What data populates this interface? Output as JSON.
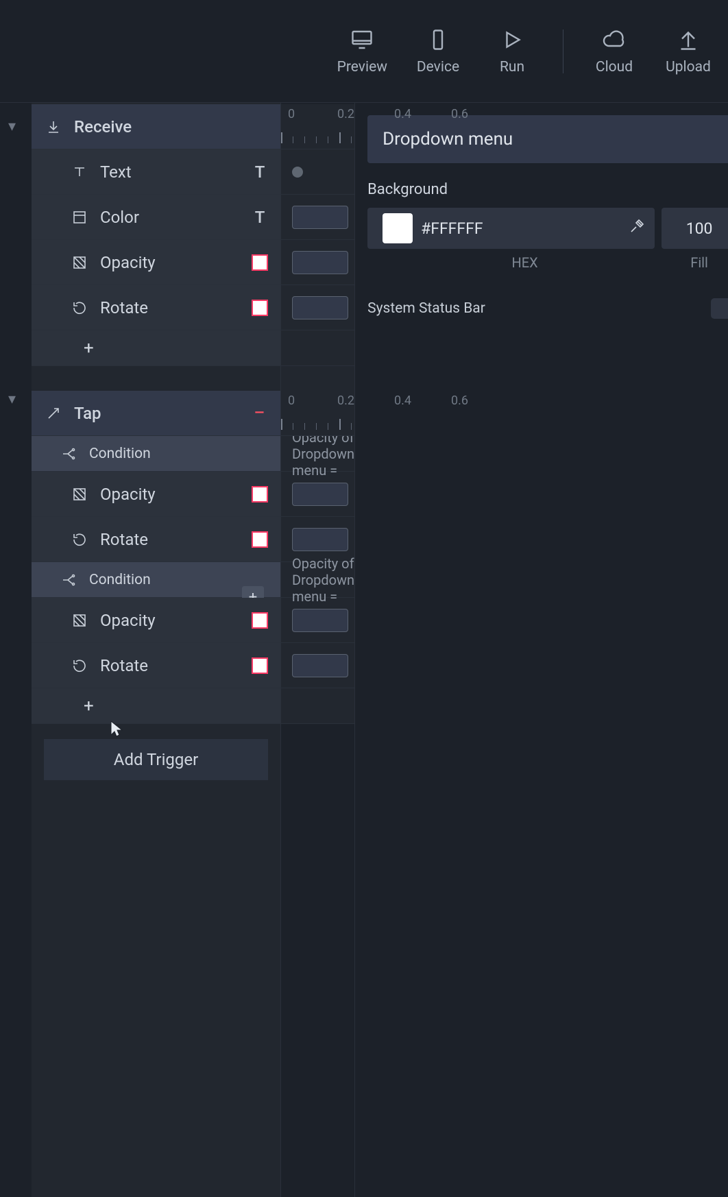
{
  "toolbar": {
    "preview": "Preview",
    "device": "Device",
    "run": "Run",
    "cloud": "Cloud",
    "upload": "Upload"
  },
  "ruler": {
    "t0": "0",
    "t1": "0.2",
    "t2": "0.4",
    "t3": "0.6"
  },
  "outline": {
    "receive": {
      "title": "Receive",
      "text": "Text",
      "color": "Color",
      "opacity": "Opacity",
      "rotate": "Rotate"
    },
    "tap": {
      "title": "Tap",
      "condition": "Condition",
      "opacity": "Opacity",
      "rotate": "Rotate"
    },
    "add_trigger": "Add Trigger"
  },
  "timeline": {
    "condition_text": "Opacity of Dropdown menu ="
  },
  "inspector": {
    "title": "Dropdown menu",
    "background_label": "Background",
    "hex": "#FFFFFF",
    "hex_caption": "HEX",
    "fill": "100",
    "fill_caption": "Fill",
    "status_bar": "System Status Bar"
  },
  "colors": {
    "white": "#FFFFFF",
    "accent_red": "#ff3b66"
  }
}
